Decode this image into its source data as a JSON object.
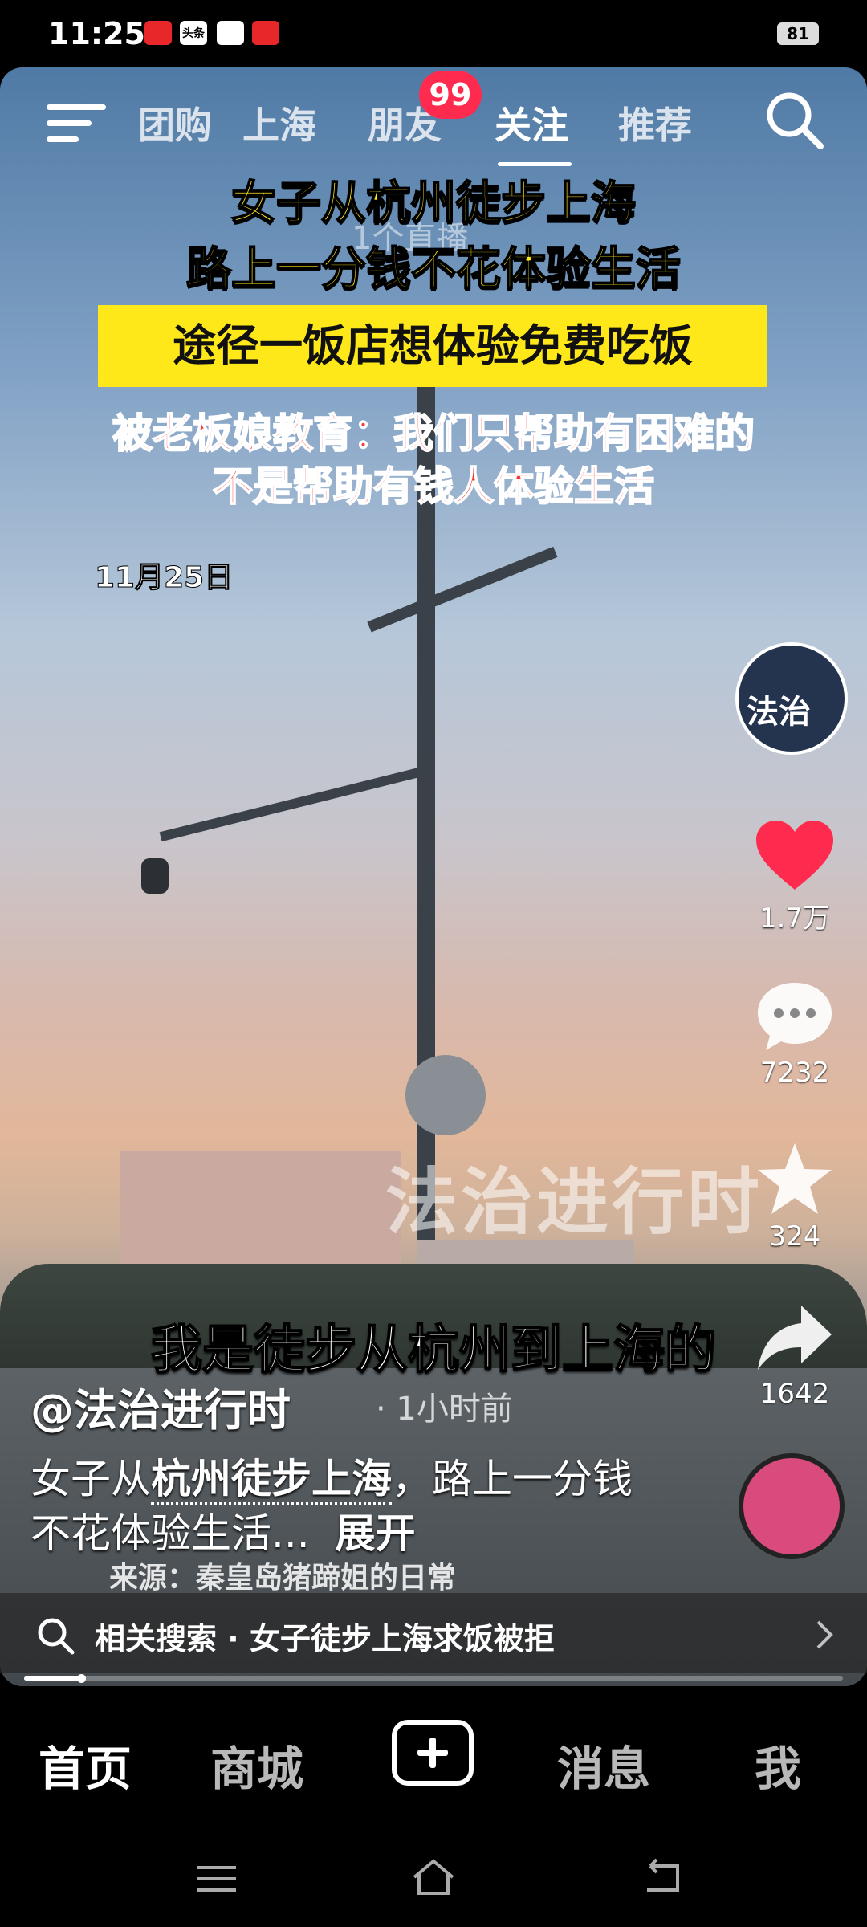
{
  "status_bar": {
    "time": "11:25",
    "icons": [
      "news-app-icon",
      "toutiao-icon",
      "message-icon",
      "app-icon"
    ],
    "icon_labels": [
      "",
      "头条",
      "",
      ""
    ],
    "battery": "81"
  },
  "top_nav": {
    "tabs": [
      {
        "label": "团购",
        "partial": true
      },
      {
        "label": "上海"
      },
      {
        "label": "朋友"
      },
      {
        "label": "关注",
        "active": true
      },
      {
        "label": "推荐"
      }
    ],
    "friends_badge": "99"
  },
  "video": {
    "ghost_text": "1个直播",
    "headline_line1": "女子从杭州徒步上海",
    "headline_line2": "路上一分钱不花体验生活",
    "yellow_banner": "途径一饭店想体验免费吃饭",
    "red_line1": "被老板娘教育：我们只帮助有困难的",
    "red_line2": "不是帮助有钱人体验生活",
    "date": "11月25日",
    "watermark": "法治进行时",
    "subtitle": "我是徒步从杭州到上海的"
  },
  "right_rail": {
    "avatar_text": "法治",
    "likes": "1.7万",
    "comments": "7232",
    "favorites": "324",
    "shares": "1642",
    "like_color": "#ff2b4e"
  },
  "caption": {
    "author": "@法治进行时",
    "time_ago": "· 1小时前",
    "desc_part1": "女子从",
    "desc_highlight": "杭州徒步上海",
    "desc_part2": "，路上一分钱不花体验生活...",
    "expand": "展开",
    "source": "来源：秦皇岛猪蹄姐的日常"
  },
  "related_search": {
    "text": "相关搜索 · 女子徒步上海求饭被拒"
  },
  "progress": {
    "fraction": 0.07
  },
  "bottom_nav": {
    "home": "首页",
    "mall": "商城",
    "messages": "消息",
    "me": "我"
  }
}
